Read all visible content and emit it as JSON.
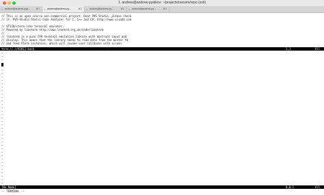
{
  "window": {
    "title": "1. andrew@andrew-pyatkov: ~/projects/neovim/repo (ssh)"
  },
  "tabs": [
    {
      "label": "andrew@andrew-pya...",
      "shortcut": "⌘1",
      "active": false
    },
    {
      "label": "andrew@andrew-py...",
      "shortcut": "⌘2",
      "active": true
    },
    {
      "label": "andrew@andrew-py...",
      "shortcut": "⌘3",
      "active": false
    },
    {
      "label": "andrew@andrew-py...",
      "shortcut": "⌘4",
      "active": false
    }
  ],
  "buffer_lines": [
    "// This is an open source non-commercial project. Dear PVS-Studio, please check",
    "// it. PVS-Studio Static Code Analyzer for C, C++ and C#: http://www.viva64.com",
    "",
    "// VT220/xterm-like terminal emulator.",
    "// Powered by libvterm http://www.leonerd.org.uk/code/libvterm",
    "//",
    "// libvterm is a pure C99 terminal emulation library with abstract input and",
    "// display. This means that the library needs to read data from the master fd",
    "// and feed VTerm instances, which will invoke user callbacks with screen"
  ],
  "status_top": {
    "left": "term://.//92811:bash",
    "pos": "1,1",
    "scroll": "All"
  },
  "status_bottom": {
    "left": "[No Name]",
    "pos": "0,0-1",
    "scroll": "All"
  },
  "empty_line_marker": "~",
  "mode_line": "-- TERMINAL --"
}
